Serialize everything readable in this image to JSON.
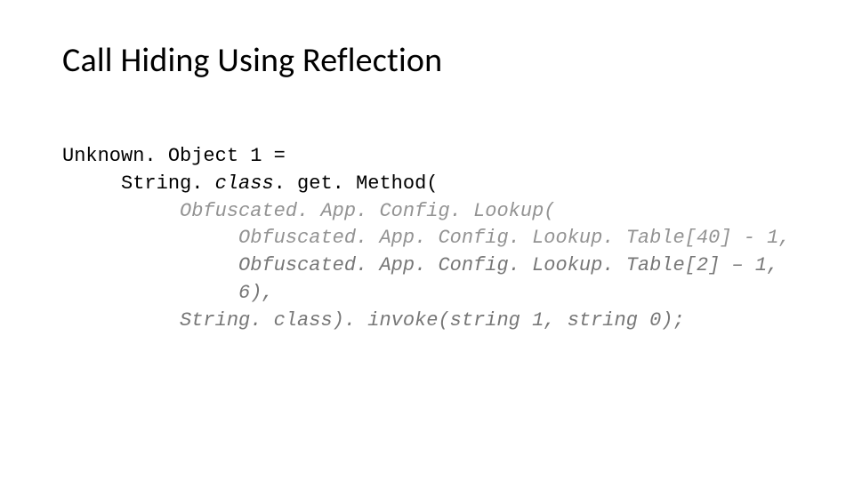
{
  "title": "Call Hiding Using Reflection",
  "code": {
    "l1a": "Unknown. Object 1 =",
    "l2a": "     String. ",
    "l2b": "class",
    "l2c": ". get. Method(",
    "l3a": "          Obfuscated. App. Config. Lookup(",
    "l4a": "               Obfuscated. App. Config. Lookup. Table[40] - 1,",
    "l5a": "               Obfuscated. App. Config. Lookup. Table[2] – 1,",
    "l6a": "               6),",
    "l7a": "          String. class). invoke(string 1, string 0);"
  }
}
